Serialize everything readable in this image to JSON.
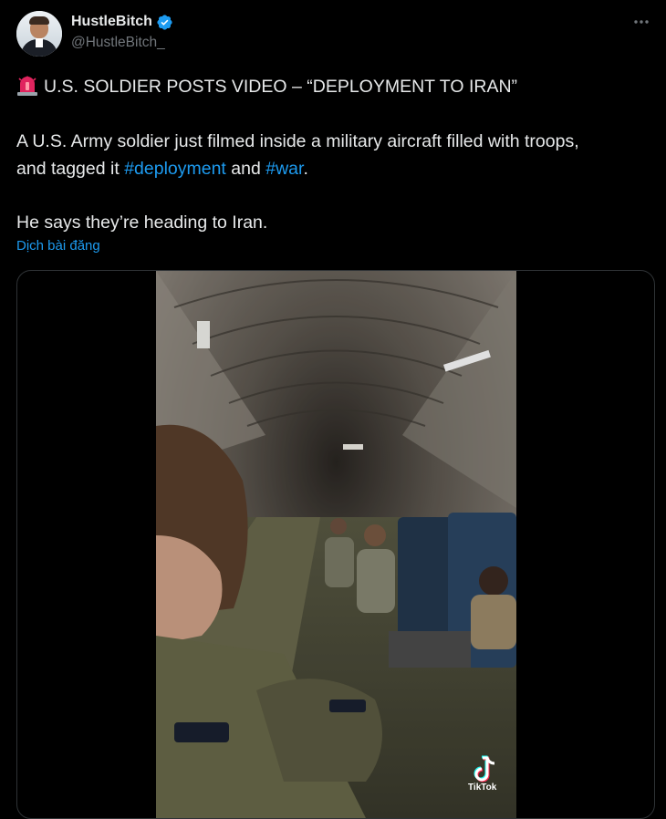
{
  "author": {
    "display_name": "HustleBitch",
    "handle": "@HustleBitch_",
    "verified": true,
    "avatar_icon": "profile-photo"
  },
  "more_icon": "ellipsis-icon",
  "post": {
    "headline_emoji": "police-siren-icon",
    "headline": "U.S. SOLDIER POSTS VIDEO – “DEPLOYMENT TO IRAN”",
    "body_prefix": "A U.S. Army soldier just filmed inside a military aircraft filled with troops,",
    "body_line2_start": "and tagged it ",
    "hashtag_1": "#deployment",
    "body_and": " and ",
    "hashtag_2": "#war",
    "body_end": ".",
    "body_line3": "He says they’re heading to Iran.",
    "translate_link": "Dịch bài đăng"
  },
  "media": {
    "type": "video",
    "watermark_label": "TikTok",
    "watermark_icon": "tiktok-logo-icon"
  },
  "colors": {
    "background": "#000000",
    "text_primary": "#e7e9ea",
    "text_secondary": "#71767b",
    "link": "#1d9bf0",
    "verified": "#1d9bf0",
    "border": "#2f3336"
  }
}
